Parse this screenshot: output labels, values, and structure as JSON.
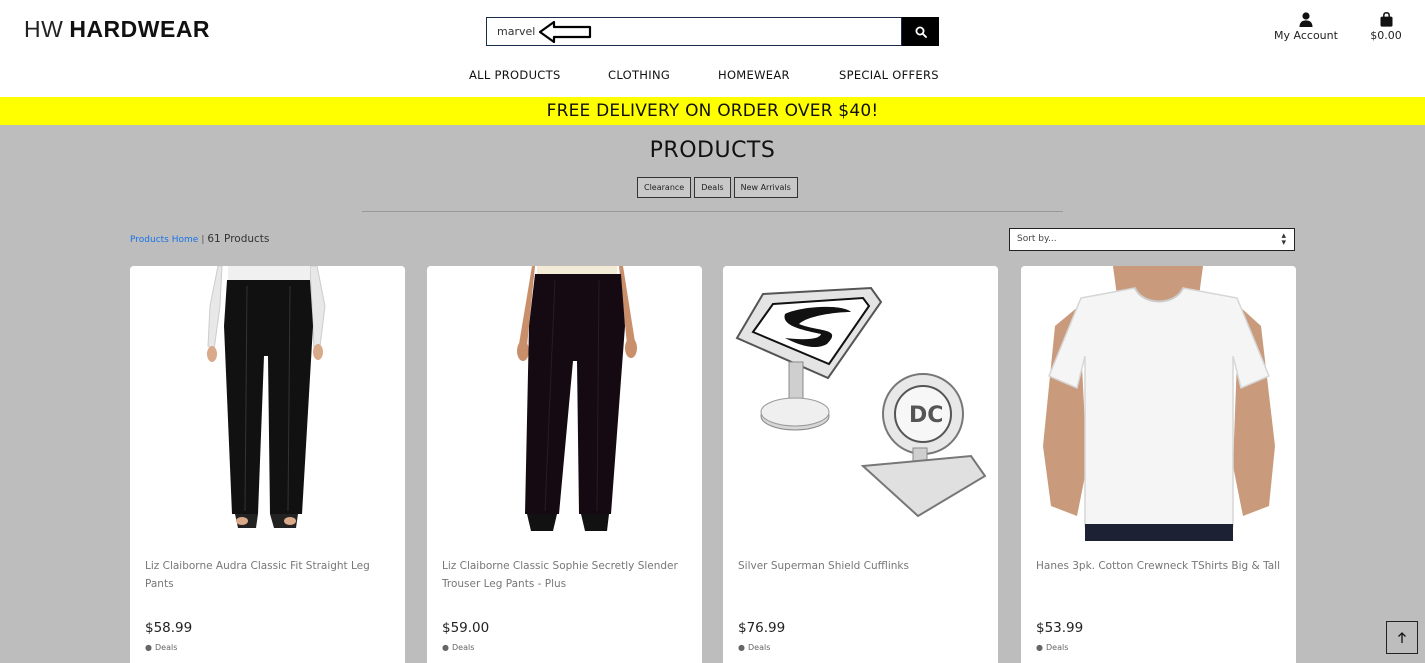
{
  "header": {
    "logo_prefix": "HW",
    "logo_name": "HARDWEAR",
    "search": {
      "value": "marvel",
      "placeholder": ""
    },
    "account_label": "My Account",
    "cart_total": "$0.00"
  },
  "nav": {
    "items": [
      {
        "label": "ALL PRODUCTS"
      },
      {
        "label": "CLOTHING"
      },
      {
        "label": "HOMEWEAR"
      },
      {
        "label": "SPECIAL OFFERS"
      }
    ]
  },
  "banner": {
    "text": "FREE DELIVERY ON ORDER OVER $40!"
  },
  "main": {
    "title": "PRODUCTS",
    "filters": [
      {
        "label": "Clearance"
      },
      {
        "label": "Deals"
      },
      {
        "label": "New Arrivals"
      }
    ],
    "breadcrumb_link": "Products Home",
    "breadcrumb_sep": "|",
    "product_count": "61 Products",
    "sort_selected": "Sort by..."
  },
  "products": [
    {
      "name": "Liz Claiborne Audra Classic Fit Straight Leg Pants",
      "price": "$58.99",
      "tag": "Deals",
      "icon": "black-pants-image"
    },
    {
      "name": "Liz Claiborne Classic Sophie Secretly Slender Trouser Leg Pants - Plus",
      "price": "$59.00",
      "tag": "Deals",
      "icon": "black-trousers-image"
    },
    {
      "name": "Silver Superman Shield Cufflinks",
      "price": "$76.99",
      "tag": "Deals",
      "icon": "cufflinks-image"
    },
    {
      "name": "Hanes 3pk. Cotton Crewneck TShirts Big & Tall",
      "price": "$53.99",
      "tag": "Deals",
      "icon": "white-tshirt-image"
    }
  ],
  "colors": {
    "banner": "#ffff00",
    "background": "#bdbdbd",
    "link": "#1a73e8",
    "search_button": "#000000"
  }
}
